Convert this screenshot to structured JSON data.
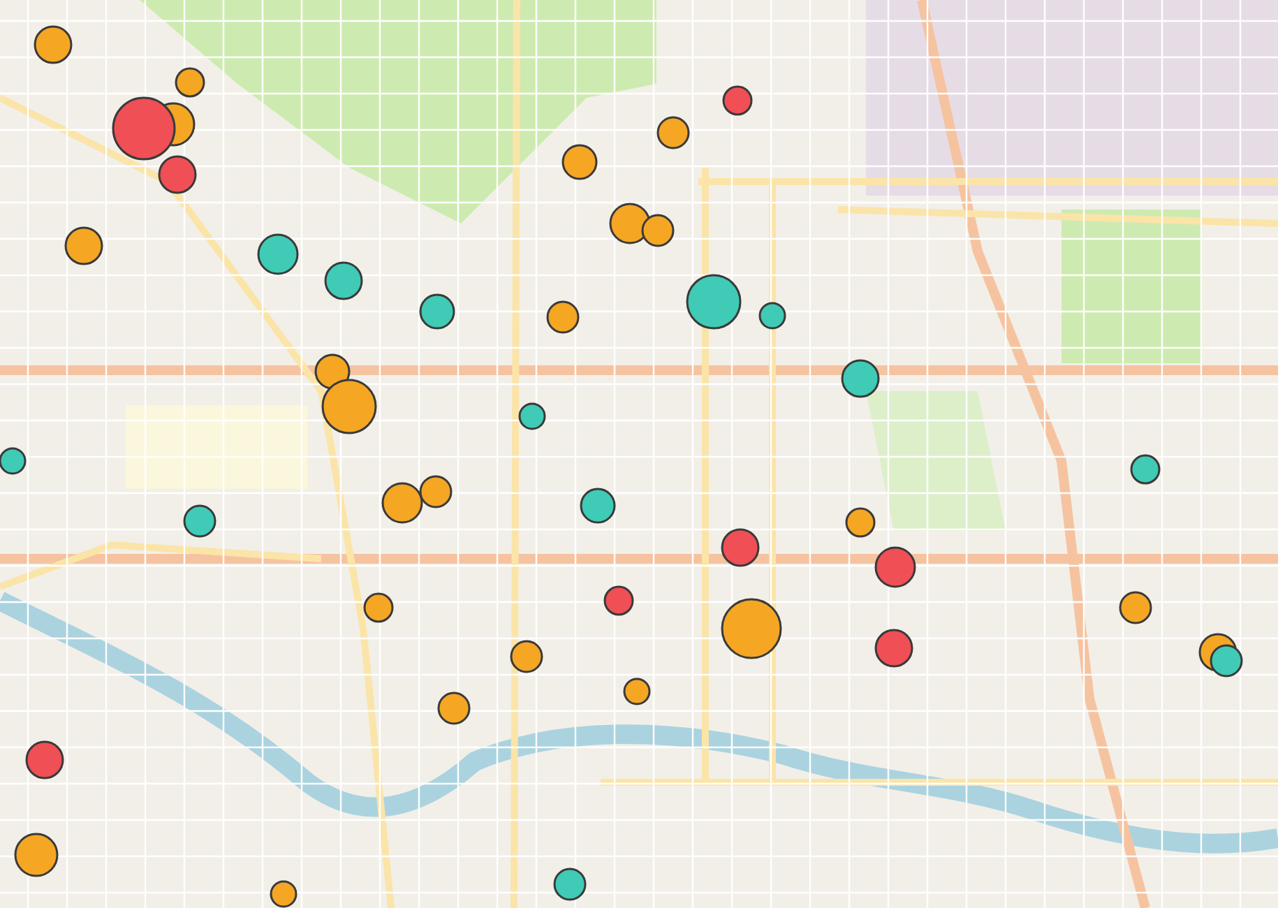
{
  "map": {
    "markers": [
      {
        "color": "#f5a623"
      },
      {
        "color": "#f5a623"
      },
      {
        "color": "#ef4f55"
      },
      {
        "color": "#f5a623"
      },
      {
        "color": "#ef4f55"
      },
      {
        "color": "#f5a623"
      },
      {
        "color": "#3fcbb5"
      },
      {
        "color": "#3fcbb5"
      },
      {
        "color": "#3fcbb5"
      },
      {
        "color": "#f5a623"
      },
      {
        "color": "#f5a623"
      },
      {
        "color": "#3fcbb5"
      },
      {
        "color": "#f5a623"
      },
      {
        "color": "#f5a623"
      },
      {
        "color": "#f5a623"
      },
      {
        "color": "#f5a623"
      },
      {
        "color": "#f5a623"
      },
      {
        "color": "#ef4f55"
      },
      {
        "color": "#3fcbb5"
      },
      {
        "color": "#3fcbb5"
      },
      {
        "color": "#3fcbb5"
      },
      {
        "color": "#f5a623"
      },
      {
        "color": "#f5a623"
      },
      {
        "color": "#3fcbb5"
      },
      {
        "color": "#ef4f55"
      },
      {
        "color": "#f5a623"
      },
      {
        "color": "#ef4f55"
      },
      {
        "color": "#ef4f55"
      },
      {
        "color": "#f5a623"
      },
      {
        "color": "#ef4f55"
      },
      {
        "color": "#f5a623"
      },
      {
        "color": "#f5a623"
      },
      {
        "color": "#f5a623"
      },
      {
        "color": "#f5a623"
      },
      {
        "color": "#ef4f55"
      },
      {
        "color": "#f5a623"
      },
      {
        "color": "#3fcbb5"
      },
      {
        "color": "#3fcbb5"
      },
      {
        "color": "#3fcbb5"
      },
      {
        "color": "#f5a623"
      },
      {
        "color": "#f5a623"
      },
      {
        "color": "#3fcbb5"
      },
      {
        "color": "#3fcbb5"
      },
      {
        "color": "#f5a623"
      }
    ]
  }
}
